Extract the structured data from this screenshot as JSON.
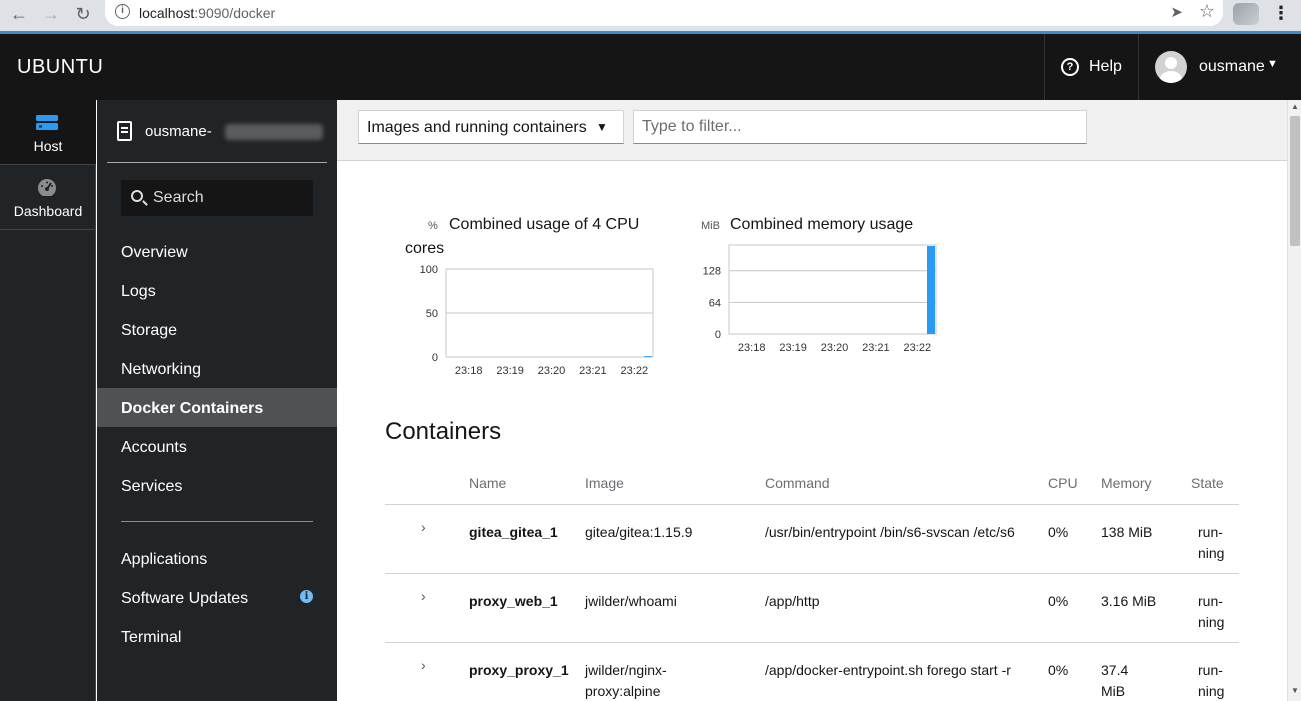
{
  "browser": {
    "url_host": "localhost",
    "url_port_path": ":9090/docker"
  },
  "masthead": {
    "brand": "UBUNTU",
    "help_label": "Help",
    "user_name": "ousmane"
  },
  "vnav": {
    "host_label": "Host",
    "dashboard_label": "Dashboard"
  },
  "sidebar": {
    "host_name": "ousmane-",
    "search_placeholder": "Search",
    "items": [
      {
        "label": "Overview"
      },
      {
        "label": "Logs"
      },
      {
        "label": "Storage"
      },
      {
        "label": "Networking"
      },
      {
        "label": "Docker Containers"
      },
      {
        "label": "Accounts"
      },
      {
        "label": "Services"
      },
      {
        "label": "Applications"
      },
      {
        "label": "Software Updates"
      },
      {
        "label": "Terminal"
      }
    ],
    "active": "Docker Containers"
  },
  "toolbar": {
    "select_value": "Images and running containers",
    "filter_placeholder": "Type to filter..."
  },
  "charts": {
    "cpu": {
      "unit": "%",
      "title_line1": "Combined usage of 4 CPU",
      "title_line2": "cores",
      "y_ticks": [
        "100",
        "50",
        "0"
      ],
      "x_ticks": [
        "23:18",
        "23:19",
        "23:20",
        "23:21",
        "23:22"
      ]
    },
    "memory": {
      "unit": "MiB",
      "title": "Combined memory usage",
      "y_ticks": [
        "128",
        "64",
        "0"
      ],
      "x_ticks": [
        "23:18",
        "23:19",
        "23:20",
        "23:21",
        "23:22"
      ]
    }
  },
  "chart_data": [
    {
      "type": "area",
      "title": "Combined usage of 4 CPU cores",
      "ylabel": "%",
      "ylim": [
        0,
        100
      ],
      "x": [
        "23:18",
        "23:19",
        "23:20",
        "23:21",
        "23:22"
      ],
      "series": [
        {
          "values": [
            0,
            0,
            0,
            0,
            1
          ]
        }
      ],
      "grid": true
    },
    {
      "type": "area",
      "title": "Combined memory usage",
      "ylabel": "MiB",
      "ylim": [
        0,
        180
      ],
      "x": [
        "23:18",
        "23:19",
        "23:20",
        "23:21",
        "23:22"
      ],
      "series": [
        {
          "values": [
            0,
            0,
            0,
            0,
            178
          ]
        }
      ],
      "grid": true
    }
  ],
  "containers": {
    "title": "Containers",
    "columns": [
      "Name",
      "Image",
      "Command",
      "CPU",
      "Memory",
      "State"
    ],
    "rows": [
      {
        "name": "gitea_gitea_1",
        "image": "gitea/gitea:1.15.9",
        "command": "/usr/bin/entrypoint /bin/s6-svscan /etc/s6",
        "cpu": "0%",
        "memory": "138 MiB",
        "state": "run-ning"
      },
      {
        "name": "proxy_web_1",
        "image": "jwilder/whoami",
        "command": "/app/http",
        "cpu": "0%",
        "memory": "3.16 MiB",
        "state": "run-ning"
      },
      {
        "name": "proxy_proxy_1",
        "image": "jwilder/nginx-proxy:alpine",
        "command": "/app/docker-entrypoint.sh forego start -r",
        "cpu": "0%",
        "memory": "37.4 MiB",
        "state": "run-ning"
      }
    ]
  },
  "colors": {
    "accent": "#2b9af3",
    "masthead_bg": "#151515",
    "nav_bg": "#212427",
    "active_item_bg": "#4f5255",
    "info_badge": "#73bcf7"
  }
}
